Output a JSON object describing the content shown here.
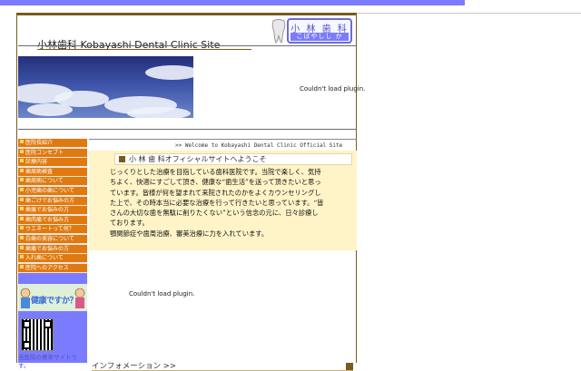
{
  "header": {
    "site_title": "小林歯科 Kobayashi Dental Clinic Site",
    "logo_main": "小 林 歯 科",
    "logo_sub": "こばやしし か"
  },
  "plugin_message": "Couldn't load plugin.",
  "nav": {
    "items": [
      "医院長紹介",
      "医院コンセプト",
      "診療内容",
      "歯周病検査",
      "歯周病について",
      "小児歯の歯について",
      "歯ごけでお悩みの方",
      "歯痛でお悩みの方",
      "歯肉痛でお悩み方",
      "ウエネートって何？",
      "白歯の美容について",
      "歯痛でお悩みの方",
      "入れ歯について",
      "医院へのアクセス"
    ],
    "kenkou_label": "健康ですか？"
  },
  "qr_note": "当医院の携帯サイトです。",
  "welcome_text": ">> Welcome to Kobayashi Dental Clinic Official Site",
  "main": {
    "heading": "小 林 歯 科オフィシャルサイトへようこそ",
    "body_lines": [
      "じっくりとした治療を目指している歯科医院です。当院で楽しく、気持",
      "ちよく、快適にすごして頂き、健康な“歯生活”を送って頂きたいと思っ",
      "ています。皆様が何を望まれて来院されたのかをよくカウンセリングし",
      "た上で、その時本当に必要な治療を行って行きたいと思っています。“皆",
      "さんの大切な歯を無駄に削りたくない”という信念の元に、日々診療し",
      "ております。",
      "顎関節症や歯周治療、審美治療に力を入れています。"
    ]
  },
  "info_heading": "インフォメーション >>",
  "colors": {
    "accent_blue": "#7b7bff",
    "nav_orange": "#e07a10",
    "content_bg": "#fff4c8",
    "frame_brown": "#7a5a20"
  }
}
